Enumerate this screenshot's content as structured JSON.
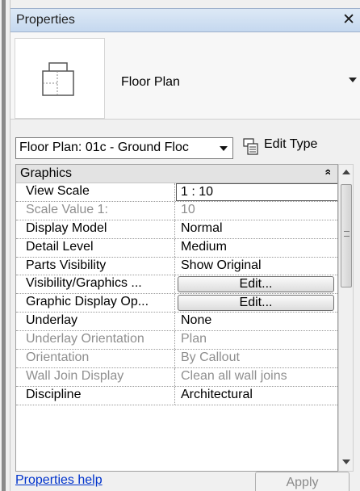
{
  "panel": {
    "title": "Properties",
    "close_glyph": "✕"
  },
  "type_selector": {
    "name": "Floor Plan",
    "icon": "floor-plan-icon"
  },
  "view_selector": {
    "value": "Floor Plan: 01c - Ground Floc",
    "edit_type_label": "Edit Type",
    "edit_type_icon": "edit-type-icon"
  },
  "grid": {
    "group_name": "Graphics",
    "collapse_glyph": "»",
    "rows": [
      {
        "name": "View Scale",
        "value": "1 : 10"
      },
      {
        "name": "Scale Value   1:",
        "value": "10"
      },
      {
        "name": "Display Model",
        "value": "Normal"
      },
      {
        "name": "Detail Level",
        "value": "Medium"
      },
      {
        "name": "Parts Visibility",
        "value": "Show Original"
      },
      {
        "name": "Visibility/Graphics ...",
        "value": "Edit..."
      },
      {
        "name": "Graphic Display Op...",
        "value": "Edit..."
      },
      {
        "name": "Underlay",
        "value": "None"
      },
      {
        "name": "Underlay Orientation",
        "value": "Plan"
      },
      {
        "name": "Orientation",
        "value": "By Callout"
      },
      {
        "name": "Wall Join Display",
        "value": "Clean all wall joins"
      },
      {
        "name": "Discipline",
        "value": "Architectural"
      }
    ]
  },
  "footer": {
    "help_link": "Properties help",
    "apply_label": "Apply"
  },
  "colors": {
    "title_bar": "#c5d8ef",
    "link": "#0033cc",
    "disabled_text": "#8f8f8f"
  }
}
